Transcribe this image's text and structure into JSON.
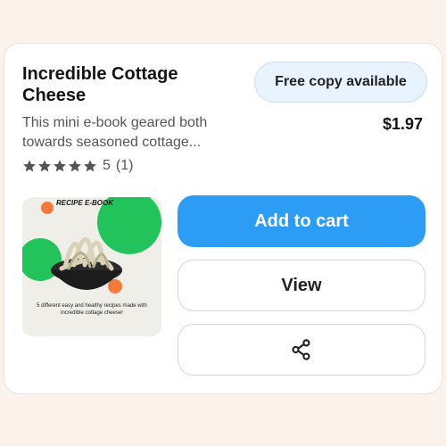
{
  "product": {
    "title": "Incredible Cottage Cheese",
    "free_badge": "Free copy available",
    "description": "This mini e-book geared both towards seasoned cottage...",
    "price": "$1.97",
    "rating": {
      "stars": 5,
      "value": "5",
      "count": "(1)"
    },
    "thumbnail": {
      "label": "RECIPE E-BOOK",
      "caption": "5 different easy and healthy recipes made with incredible cottage cheese!"
    }
  },
  "actions": {
    "add_to_cart": "Add to cart",
    "view": "View",
    "share_icon": "share-icon"
  },
  "colors": {
    "background": "#fbf2ec",
    "accent": "#2d9cf4",
    "badge_bg": "#e9f3fe",
    "thumb_green": "#22c35a",
    "thumb_orange": "#f47a3c"
  }
}
